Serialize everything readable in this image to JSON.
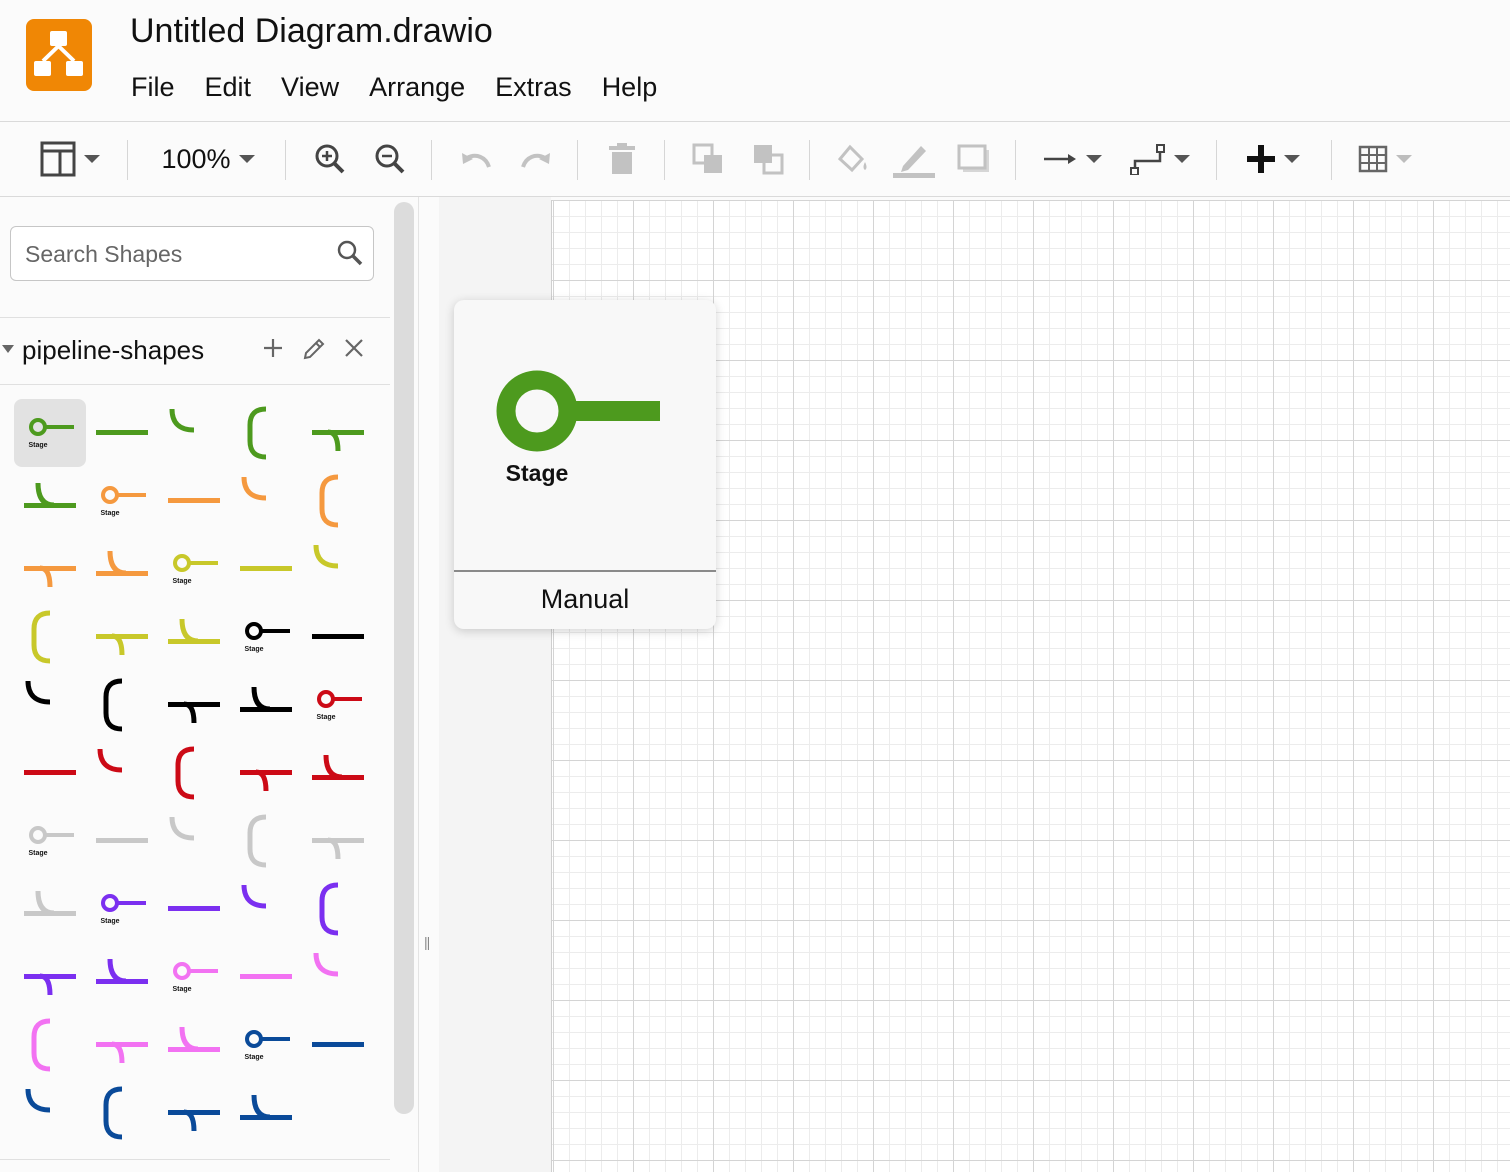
{
  "app": {
    "logo_icon": "drawio-logo-icon",
    "title": "Untitled Diagram.drawio",
    "brand_color": "#f08705"
  },
  "menu": [
    "File",
    "Edit",
    "View",
    "Arrange",
    "Extras",
    "Help"
  ],
  "toolbar": {
    "zoom": "100%",
    "icons": [
      "format-panel-icon",
      "zoom-in-icon",
      "zoom-out-icon",
      "undo-icon",
      "redo-icon",
      "delete-icon",
      "to-front-icon",
      "to-back-icon",
      "fill-color-icon",
      "line-color-icon",
      "shadow-icon",
      "connection-arrow-icon",
      "waypoint-icon",
      "insert-plus-icon",
      "table-icon"
    ]
  },
  "sidebar": {
    "search_placeholder": "Search Shapes",
    "library": {
      "name": "pipeline-shapes",
      "actions": [
        "add-icon",
        "edit-icon",
        "close-icon"
      ],
      "shape_label": "Stage",
      "shapes": [
        {
          "kind": "stage",
          "color": "#4d9a1e"
        },
        {
          "kind": "line",
          "color": "#4d9a1e"
        },
        {
          "kind": "curve-tr",
          "color": "#4d9a1e"
        },
        {
          "kind": "bracket-l",
          "color": "#4d9a1e"
        },
        {
          "kind": "branch-down",
          "color": "#4d9a1e"
        },
        {
          "kind": "merge-up",
          "color": "#4d9a1e"
        },
        {
          "kind": "stage",
          "color": "#f5993f"
        },
        {
          "kind": "line",
          "color": "#f5993f"
        },
        {
          "kind": "curve-tr",
          "color": "#f5993f"
        },
        {
          "kind": "bracket-l",
          "color": "#f5993f"
        },
        {
          "kind": "branch-down",
          "color": "#f5993f"
        },
        {
          "kind": "merge-up",
          "color": "#f5993f"
        },
        {
          "kind": "stage",
          "color": "#c8c82a"
        },
        {
          "kind": "line",
          "color": "#c8c82a"
        },
        {
          "kind": "curve-tr",
          "color": "#c8c82a"
        },
        {
          "kind": "bracket-l",
          "color": "#c8c82a"
        },
        {
          "kind": "branch-down",
          "color": "#c8c82a"
        },
        {
          "kind": "merge-up",
          "color": "#c8c82a"
        },
        {
          "kind": "stage",
          "color": "#000000"
        },
        {
          "kind": "line",
          "color": "#000000"
        },
        {
          "kind": "curve-tr",
          "color": "#000000"
        },
        {
          "kind": "bracket-l",
          "color": "#000000"
        },
        {
          "kind": "branch-down",
          "color": "#000000"
        },
        {
          "kind": "merge-up",
          "color": "#000000"
        },
        {
          "kind": "stage",
          "color": "#cc0a16"
        },
        {
          "kind": "line",
          "color": "#cc0a16"
        },
        {
          "kind": "curve-tr",
          "color": "#cc0a16"
        },
        {
          "kind": "bracket-l",
          "color": "#cc0a16"
        },
        {
          "kind": "branch-down",
          "color": "#cc0a16"
        },
        {
          "kind": "merge-up",
          "color": "#cc0a16"
        },
        {
          "kind": "stage",
          "color": "#c8c8c8"
        },
        {
          "kind": "line",
          "color": "#c8c8c8"
        },
        {
          "kind": "curve-tr",
          "color": "#c8c8c8"
        },
        {
          "kind": "bracket-l",
          "color": "#c8c8c8"
        },
        {
          "kind": "branch-down",
          "color": "#c8c8c8"
        },
        {
          "kind": "merge-up",
          "color": "#c8c8c8"
        },
        {
          "kind": "stage",
          "color": "#7b2ff0"
        },
        {
          "kind": "line",
          "color": "#7b2ff0"
        },
        {
          "kind": "curve-tr",
          "color": "#7b2ff0"
        },
        {
          "kind": "bracket-l",
          "color": "#7b2ff0"
        },
        {
          "kind": "branch-down",
          "color": "#7b2ff0"
        },
        {
          "kind": "merge-up",
          "color": "#7b2ff0"
        },
        {
          "kind": "stage",
          "color": "#f272f2"
        },
        {
          "kind": "line",
          "color": "#f272f2"
        },
        {
          "kind": "curve-tr",
          "color": "#f272f2"
        },
        {
          "kind": "bracket-l",
          "color": "#f272f2"
        },
        {
          "kind": "branch-down",
          "color": "#f272f2"
        },
        {
          "kind": "merge-up",
          "color": "#f272f2"
        },
        {
          "kind": "stage",
          "color": "#0a4a99"
        },
        {
          "kind": "line",
          "color": "#0a4a99"
        },
        {
          "kind": "curve-tr",
          "color": "#0a4a99"
        },
        {
          "kind": "bracket-l",
          "color": "#0a4a99"
        },
        {
          "kind": "branch-down",
          "color": "#0a4a99"
        },
        {
          "kind": "merge-up",
          "color": "#0a4a99"
        }
      ]
    }
  },
  "preview": {
    "shape_label": "Stage",
    "caption": "Manual",
    "color": "#4d9a1e"
  }
}
